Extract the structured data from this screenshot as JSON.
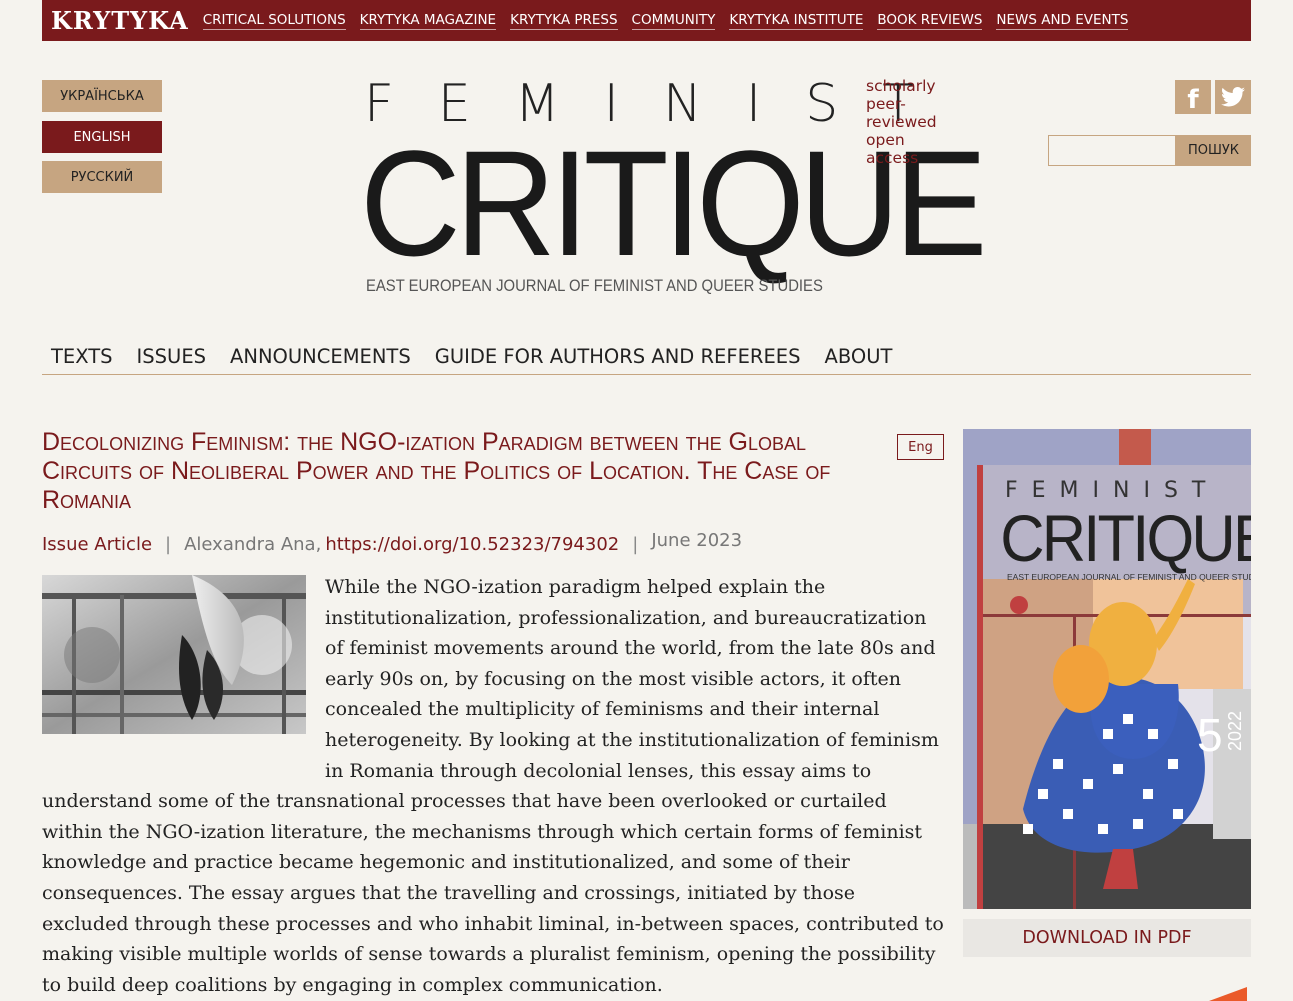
{
  "topbar": {
    "logo": "KRYTYKA",
    "links": [
      "CRITICAL SOLUTIONS",
      "KRYTYKA MAGAZINE",
      "KRYTYKA PRESS",
      "COMMUNITY",
      "KRYTYKA INSTITUTE",
      "BOOK REVIEWS",
      "NEWS AND EVENTS"
    ]
  },
  "languages": [
    "УКРАЇНСЬКА",
    "ENGLISH",
    "РУССКИЙ"
  ],
  "masthead": {
    "feminist": "FEMINIST",
    "critique": "CRITIQUE",
    "subtitle": "EAST EUROPEAN JOURNAL OF FEMINIST AND QUEER STUDIES",
    "tagline": "scholarly peer-reviewed open access"
  },
  "social": {
    "facebook_icon": "f",
    "twitter_icon": "twitter-bird"
  },
  "search": {
    "button": "ПОШУК",
    "placeholder": ""
  },
  "mainnav": [
    "TEXTS",
    "ISSUES",
    "ANNOUNCEMENTS",
    "GUIDE FOR AUTHORS AND REFEREES",
    "ABOUT"
  ],
  "article": {
    "title": "Decolonizing Feminism: the NGO-ization Paradigm between the Global Circuits of Neoliberal Power and the Politics of Location. The Case of Romania",
    "lang_badge": "Eng",
    "type": "Issue Article",
    "sep": "|",
    "author": "Alexandra Ana,",
    "doi": "https://doi.org/10.52323/794302",
    "date": "June 2023",
    "abstract": "While the NGO-ization paradigm helped explain the institutionalization, professionalization, and bureaucratization of feminist movements around the world, from the late 80s and early 90s on, by focusing on the most visible actors, it often concealed the multiplicity of feminisms and their internal heterogeneity. By looking at the institutionalization of feminism in Romania through decolonial lenses, this essay aims to understand some of the transnational processes that have been overlooked or curtailed within the NGO-ization literature, the mechanisms through which certain forms of feminist knowledge and practice became hegemonic and institutionalized, and some of their consequences. The essay argues that the travelling and crossings, initiated by those excluded through these processes and who inhabit liminal, in-between spaces, contributed to making visible multiple worlds of sense towards a pluralist feminism, opening the possibility to build deep coalitions by engaging in complex communication."
  },
  "cover": {
    "feminist": "FEMINIST",
    "critique": "CRITIQUE",
    "subtitle": "EAST EUROPEAN JOURNAL OF FEMINIST AND QUEER STUDIES",
    "issue": "5",
    "year": "2022"
  },
  "download": "DOWNLOAD IN PDF",
  "colors": {
    "brand": "#7a1a1c",
    "tan": "#c6a581",
    "background": "#f5f3ee"
  }
}
